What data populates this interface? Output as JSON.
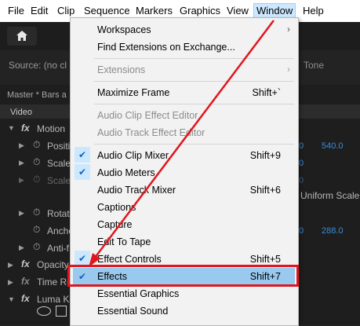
{
  "menubar": [
    "File",
    "Edit",
    "Clip",
    "Sequence",
    "Markers",
    "Graphics",
    "View",
    "Window",
    "Help"
  ],
  "source_label": "Source: (no cl",
  "right_tone": "Tone",
  "right_uniform": "Uniform Scale",
  "panel_tab": "Master * Bars a",
  "video_label": "Video",
  "properties": [
    "Motion",
    "Positi",
    "Scale",
    "Scale",
    "Rotat",
    "Ancho",
    "Anti-f",
    "Opacity",
    "Time Re",
    "Luma Ke"
  ],
  "values": {
    "position_x": "0",
    "position_y": "540.0",
    "scale": "0",
    "scale_width": "0",
    "anchor_x": "0",
    "anchor_y": "288.0"
  },
  "menu": {
    "workspaces": "Workspaces",
    "find_extensions": "Find Extensions on Exchange...",
    "extensions": "Extensions",
    "maximize_frame": "Maximize Frame",
    "maximize_sc": "Shift+`",
    "audio_clip_effect_editor": "Audio Clip Effect Editor",
    "audio_track_effect_editor": "Audio Track Effect Editor",
    "audio_clip_mixer": "Audio Clip Mixer",
    "audio_clip_mixer_sc": "Shift+9",
    "audio_meters": "Audio Meters",
    "audio_track_mixer": "Audio Track Mixer",
    "audio_track_mixer_sc": "Shift+6",
    "captions": "Captions",
    "capture": "Capture",
    "edit_to_tape": "Edit To Tape",
    "effect_controls": "Effect Controls",
    "effect_controls_sc": "Shift+5",
    "effects": "Effects",
    "effects_sc": "Shift+7",
    "essential_graphics": "Essential Graphics",
    "essential_sound": "Essential Sound"
  },
  "colors": {
    "annotation_red": "#e0161e",
    "highlight_blue": "#99c9ee",
    "check_blue": "#1560bd"
  }
}
